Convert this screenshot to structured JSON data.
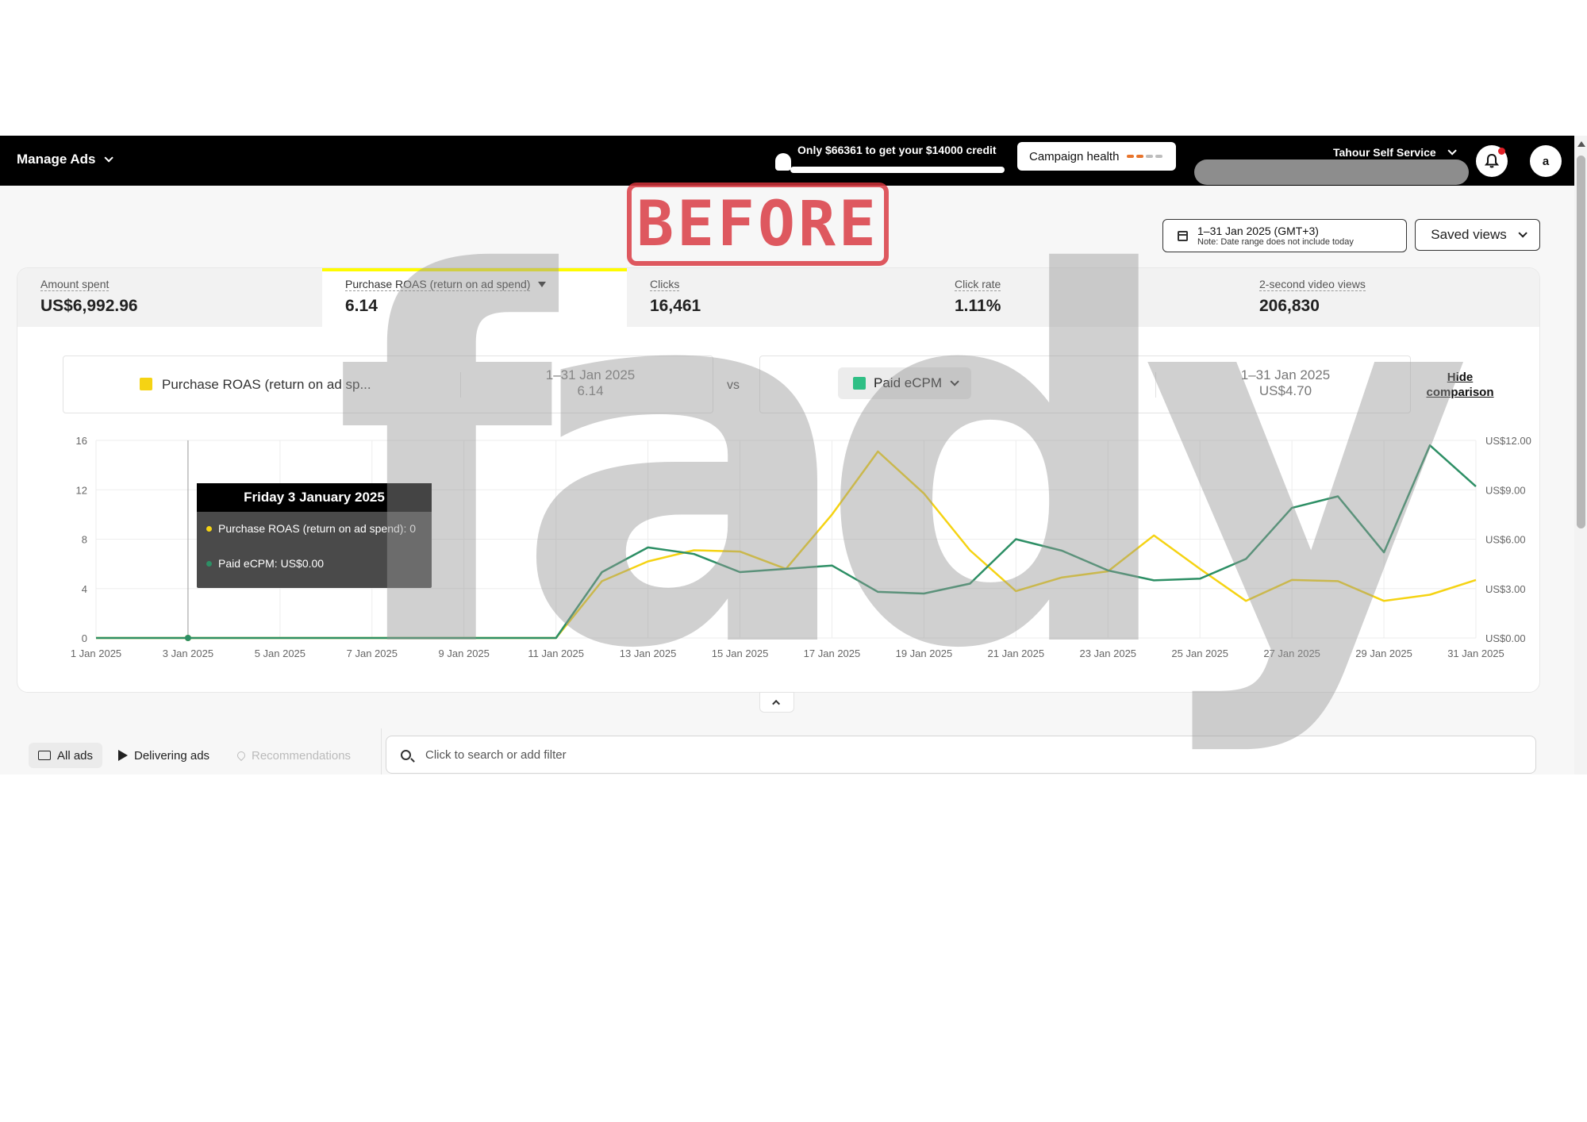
{
  "topbar": {
    "menu_label": "Manage Ads",
    "credit_text": "Only $66361 to get your $14000 credit",
    "campaign_health_label": "Campaign health",
    "health_colors": [
      "#e8742c",
      "#e8742c",
      "#bdbdbd",
      "#bdbdbd"
    ],
    "account_name": "Tahour Self Service",
    "avatar_initial": "a",
    "notification_icon": "bell-icon"
  },
  "stamp_text": "BEFORE",
  "watermark_text": "fady",
  "toolbar": {
    "date_range": "1–31 Jan 2025 (GMT+3)",
    "date_note": "Note: Date range does not include today",
    "saved_views_label": "Saved views"
  },
  "metrics": [
    {
      "label": "Amount spent",
      "value": "US$6,992.96"
    },
    {
      "label": "Purchase ROAS (return on ad spend)",
      "value": "6.14"
    },
    {
      "label": "Clicks",
      "value": "16,461"
    },
    {
      "label": "Click rate",
      "value": "1.11%"
    },
    {
      "label": "2-second video views",
      "value": "206,830"
    }
  ],
  "comparison": {
    "left_metric": "Purchase ROAS (return on ad sp...",
    "left_color": "#f5d313",
    "left_period": "1–31 Jan 2025",
    "left_value": "6.14",
    "vs_label": "vs",
    "right_metric": "Paid eCPM",
    "right_color": "#2fbf85",
    "right_period": "1–31 Jan 2025",
    "right_value": "US$4.70",
    "hide_label_1": "Hide",
    "hide_label_2": "comparison"
  },
  "tooltip": {
    "title": "Friday 3 January 2025",
    "line1": "Purchase ROAS (return on ad spend): 0",
    "line2": "Paid eCPM: US$0.00"
  },
  "chart_data": {
    "type": "line",
    "x": [
      "1 Jan",
      "2 Jan",
      "3 Jan",
      "4 Jan",
      "5 Jan",
      "6 Jan",
      "7 Jan",
      "8 Jan",
      "9 Jan",
      "10 Jan",
      "11 Jan",
      "12 Jan",
      "13 Jan",
      "14 Jan",
      "15 Jan",
      "16 Jan",
      "17 Jan",
      "18 Jan",
      "19 Jan",
      "20 Jan",
      "21 Jan",
      "22 Jan",
      "23 Jan",
      "24 Jan",
      "25 Jan",
      "26 Jan",
      "27 Jan",
      "28 Jan",
      "29 Jan",
      "30 Jan",
      "31 Jan"
    ],
    "x_tick_labels": [
      "1 Jan 2025",
      "3 Jan 2025",
      "5 Jan 2025",
      "7 Jan 2025",
      "9 Jan 2025",
      "11 Jan 2025",
      "13 Jan 2025",
      "15 Jan 2025",
      "17 Jan 2025",
      "19 Jan 2025",
      "21 Jan 2025",
      "23 Jan 2025",
      "25 Jan 2025",
      "27 Jan 2025",
      "29 Jan 2025",
      "31 Jan 2025"
    ],
    "y_left_ticks": [
      "0",
      "4",
      "8",
      "12",
      "16"
    ],
    "y_left_range": [
      0,
      16
    ],
    "y_right_ticks": [
      "US$0.00",
      "US$3.00",
      "US$6.00",
      "US$9.00",
      "US$12.00"
    ],
    "y_right_range": [
      0,
      12
    ],
    "series": [
      {
        "name": "Purchase ROAS (return on ad spend)",
        "color": "#f5d313",
        "axis": "left",
        "values": [
          0,
          0,
          0,
          0,
          0,
          0,
          0,
          0,
          0,
          0,
          0,
          4.6,
          6.2,
          7.1,
          7.0,
          5.6,
          10.0,
          15.1,
          11.7,
          7.1,
          3.8,
          4.9,
          5.4,
          8.3,
          5.6,
          3.0,
          4.7,
          4.6,
          3.0,
          3.5,
          4.7
        ]
      },
      {
        "name": "Paid eCPM",
        "color": "#2d8f65",
        "axis": "right",
        "values": [
          0,
          0,
          0,
          0,
          0,
          0,
          0,
          0,
          0,
          0,
          0,
          4.0,
          5.5,
          5.1,
          4.0,
          4.2,
          4.4,
          2.8,
          2.7,
          3.3,
          6.0,
          5.3,
          4.1,
          3.5,
          3.6,
          4.8,
          7.9,
          8.6,
          5.2,
          11.7,
          9.2
        ]
      }
    ],
    "grid": true,
    "highlight_index": 2
  },
  "filters": {
    "all_ads": "All ads",
    "delivering_ads": "Delivering ads",
    "recommendations": "Recommendations",
    "search_placeholder": "Click to search or add filter"
  }
}
